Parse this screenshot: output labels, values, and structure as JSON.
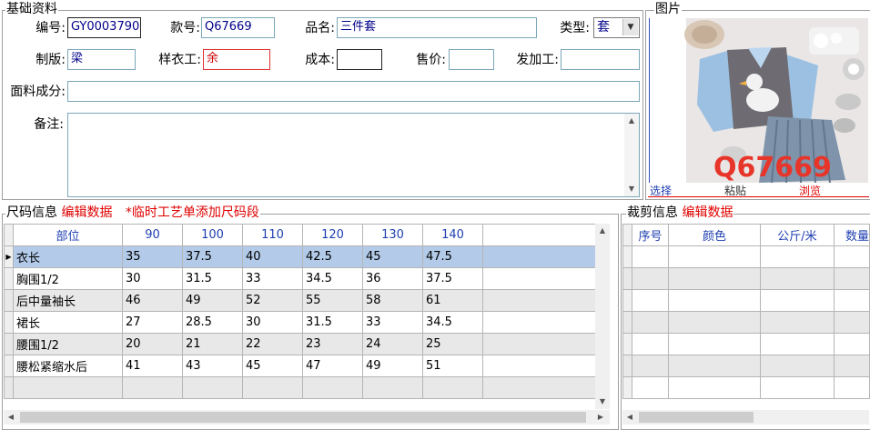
{
  "basic": {
    "title": "基础资料",
    "code_label": "编号:",
    "code_value": "GY0003790",
    "style_label": "款号:",
    "style_value": "Q67669",
    "name_label": "品名:",
    "name_value": "三件套",
    "type_label": "类型:",
    "type_value": "套",
    "maker_label": "制版:",
    "maker_value": "梁",
    "sample_label": "样衣工:",
    "sample_value": "余",
    "cost_label": "成本:",
    "cost_value": "",
    "price_label": "售价:",
    "price_value": "",
    "process_label": "发加工:",
    "process_value": "",
    "fabric_label": "面料成分:",
    "fabric_value": "",
    "note_label": "备注:",
    "note_value": ""
  },
  "picture": {
    "title": "图片",
    "watermark": "Q67669",
    "select_label": "选择",
    "paste_label": "粘贴",
    "browse_label": "浏览"
  },
  "size": {
    "title": "尺码信息",
    "edit_label": "编辑数据",
    "note": "*临时工艺单添加尺码段",
    "columns": [
      "部位",
      "90",
      "100",
      "110",
      "120",
      "130",
      "140"
    ],
    "rows": [
      [
        "衣长",
        "35",
        "37.5",
        "40",
        "42.5",
        "45",
        "47.5"
      ],
      [
        "胸围1/2",
        "30",
        "31.5",
        "33",
        "34.5",
        "36",
        "37.5"
      ],
      [
        "后中量袖长",
        "46",
        "49",
        "52",
        "55",
        "58",
        "61"
      ],
      [
        "裙长",
        "27",
        "28.5",
        "30",
        "31.5",
        "33",
        "34.5"
      ],
      [
        "腰围1/2",
        "20",
        "21",
        "22",
        "23",
        "24",
        "25"
      ],
      [
        "腰松紧缩水后",
        "41",
        "43",
        "45",
        "47",
        "49",
        "51"
      ]
    ]
  },
  "cut": {
    "title": "裁剪信息",
    "edit_label": "编辑数据",
    "columns": [
      "序号",
      "颜色",
      "公斤/米",
      "数量"
    ]
  },
  "colors": {
    "accent_red": "#e00000",
    "header_blue": "#1f3fb0",
    "selected_row": "#b3cbe9"
  }
}
